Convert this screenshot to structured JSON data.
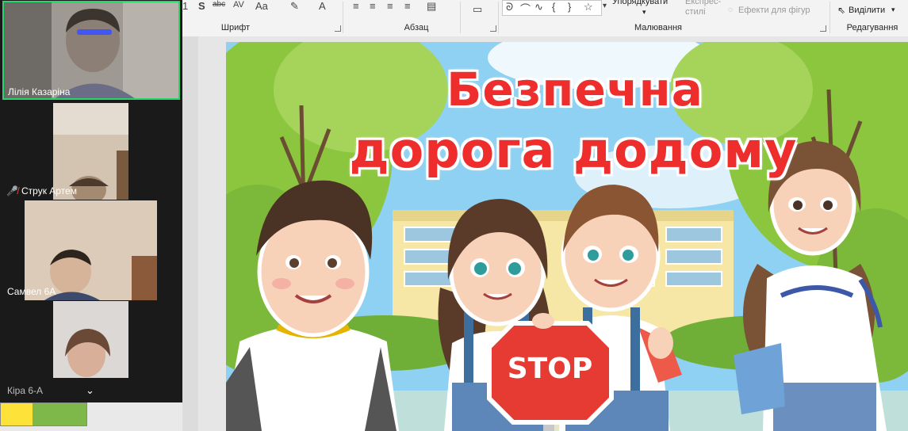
{
  "ribbon": {
    "font_group_label": "Шрифт",
    "paragraph_group_label": "Абзац",
    "drawing_group_label": "Малювання",
    "editing_group_label": "Редагування",
    "arrange_label": "Упорядкувати",
    "quick_styles_label": "Експрес-стилі",
    "shape_effects_label": "Ефекти для фігур",
    "select_label": "Виділити"
  },
  "participants": [
    {
      "name": "Лілія Казаріна"
    },
    {
      "name": "Струк Артем"
    },
    {
      "name": "Самвел 6А"
    },
    {
      "name": "Кіра 6-А"
    }
  ],
  "slide": {
    "title_line1": "Безпечна",
    "title_line2": "дорога додому",
    "sign_text": "STOP"
  },
  "colors": {
    "accent_green": "#2ad36c",
    "title_red": "#ee2d2d",
    "stop_red": "#e63b33"
  }
}
